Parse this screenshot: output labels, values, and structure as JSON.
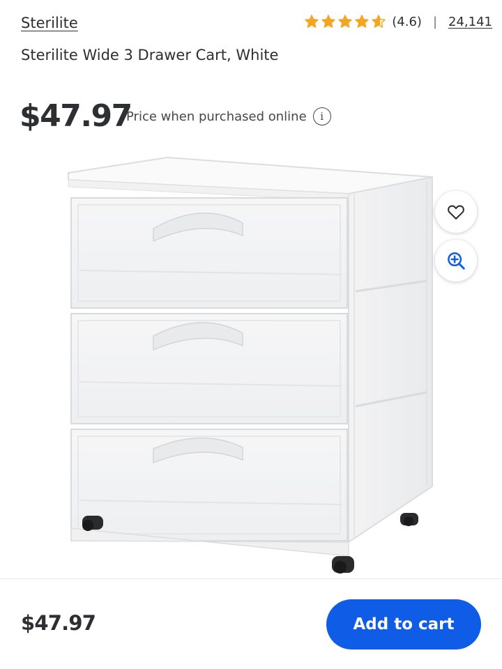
{
  "product": {
    "brand": "Sterilite",
    "title": "Sterilite Wide 3 Drawer Cart, White",
    "rating_value": 4.6,
    "rating_text": "(4.6)",
    "separator": "|",
    "review_count": "24,141",
    "price": "$47.97",
    "price_note": "Price when purchased online",
    "info_icon": "i"
  },
  "image": {
    "subject": "white-3-drawer-cart"
  },
  "actions": {
    "favorite_icon": "heart-icon",
    "zoom_icon": "zoom-in-icon"
  },
  "bottom_bar": {
    "price": "$47.97",
    "add_to_cart_label": "Add to cart"
  },
  "colors": {
    "star": "#f5a524",
    "primary_button": "#0f5ce6",
    "zoom_icon": "#0f5ce6",
    "text": "#2e2f32"
  }
}
